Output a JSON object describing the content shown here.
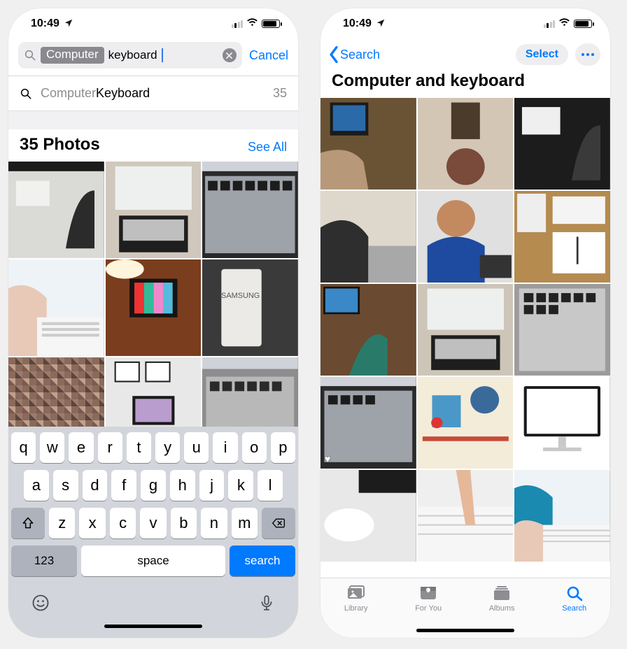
{
  "status": {
    "time": "10:49"
  },
  "left": {
    "search": {
      "chip": "Computer",
      "typed": "keyboard",
      "cancel": "Cancel"
    },
    "suggestion": {
      "faint": "Computer ",
      "bold": "Keyboard",
      "count": "35"
    },
    "section": {
      "heading": "35 Photos",
      "see_all": "See All"
    },
    "keyboard": {
      "row1": [
        "q",
        "w",
        "e",
        "r",
        "t",
        "y",
        "u",
        "i",
        "o",
        "p"
      ],
      "row2": [
        "a",
        "s",
        "d",
        "f",
        "g",
        "h",
        "j",
        "k",
        "l"
      ],
      "row3": [
        "z",
        "x",
        "c",
        "v",
        "b",
        "n",
        "m"
      ],
      "numKey": "123",
      "spaceKey": "space",
      "actionKey": "search"
    }
  },
  "right": {
    "back_label": "Search",
    "select_label": "Select",
    "title": "Computer and  keyboard",
    "tabs": {
      "library": "Library",
      "foryou": "For You",
      "albums": "Albums",
      "search": "Search"
    }
  }
}
